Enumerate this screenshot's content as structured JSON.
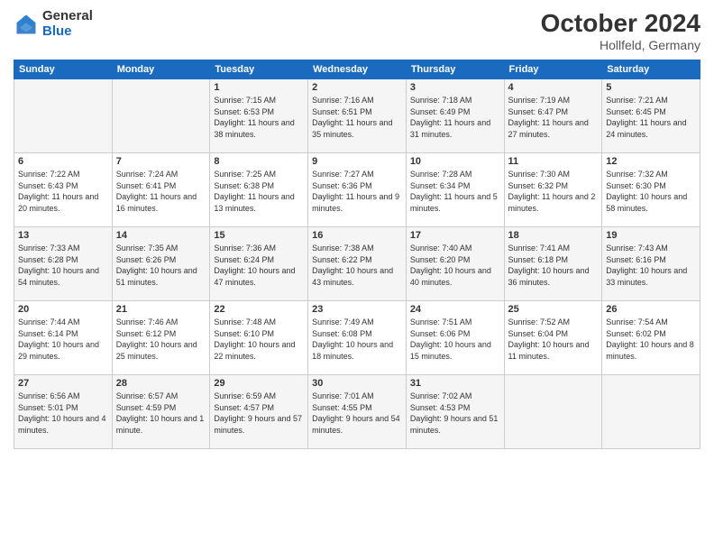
{
  "header": {
    "logo_general": "General",
    "logo_blue": "Blue",
    "month": "October 2024",
    "location": "Hollfeld, Germany"
  },
  "days_of_week": [
    "Sunday",
    "Monday",
    "Tuesday",
    "Wednesday",
    "Thursday",
    "Friday",
    "Saturday"
  ],
  "weeks": [
    [
      {
        "day": "",
        "sunrise": "",
        "sunset": "",
        "daylight": ""
      },
      {
        "day": "",
        "sunrise": "",
        "sunset": "",
        "daylight": ""
      },
      {
        "day": "1",
        "sunrise": "Sunrise: 7:15 AM",
        "sunset": "Sunset: 6:53 PM",
        "daylight": "Daylight: 11 hours and 38 minutes."
      },
      {
        "day": "2",
        "sunrise": "Sunrise: 7:16 AM",
        "sunset": "Sunset: 6:51 PM",
        "daylight": "Daylight: 11 hours and 35 minutes."
      },
      {
        "day": "3",
        "sunrise": "Sunrise: 7:18 AM",
        "sunset": "Sunset: 6:49 PM",
        "daylight": "Daylight: 11 hours and 31 minutes."
      },
      {
        "day": "4",
        "sunrise": "Sunrise: 7:19 AM",
        "sunset": "Sunset: 6:47 PM",
        "daylight": "Daylight: 11 hours and 27 minutes."
      },
      {
        "day": "5",
        "sunrise": "Sunrise: 7:21 AM",
        "sunset": "Sunset: 6:45 PM",
        "daylight": "Daylight: 11 hours and 24 minutes."
      }
    ],
    [
      {
        "day": "6",
        "sunrise": "Sunrise: 7:22 AM",
        "sunset": "Sunset: 6:43 PM",
        "daylight": "Daylight: 11 hours and 20 minutes."
      },
      {
        "day": "7",
        "sunrise": "Sunrise: 7:24 AM",
        "sunset": "Sunset: 6:41 PM",
        "daylight": "Daylight: 11 hours and 16 minutes."
      },
      {
        "day": "8",
        "sunrise": "Sunrise: 7:25 AM",
        "sunset": "Sunset: 6:38 PM",
        "daylight": "Daylight: 11 hours and 13 minutes."
      },
      {
        "day": "9",
        "sunrise": "Sunrise: 7:27 AM",
        "sunset": "Sunset: 6:36 PM",
        "daylight": "Daylight: 11 hours and 9 minutes."
      },
      {
        "day": "10",
        "sunrise": "Sunrise: 7:28 AM",
        "sunset": "Sunset: 6:34 PM",
        "daylight": "Daylight: 11 hours and 5 minutes."
      },
      {
        "day": "11",
        "sunrise": "Sunrise: 7:30 AM",
        "sunset": "Sunset: 6:32 PM",
        "daylight": "Daylight: 11 hours and 2 minutes."
      },
      {
        "day": "12",
        "sunrise": "Sunrise: 7:32 AM",
        "sunset": "Sunset: 6:30 PM",
        "daylight": "Daylight: 10 hours and 58 minutes."
      }
    ],
    [
      {
        "day": "13",
        "sunrise": "Sunrise: 7:33 AM",
        "sunset": "Sunset: 6:28 PM",
        "daylight": "Daylight: 10 hours and 54 minutes."
      },
      {
        "day": "14",
        "sunrise": "Sunrise: 7:35 AM",
        "sunset": "Sunset: 6:26 PM",
        "daylight": "Daylight: 10 hours and 51 minutes."
      },
      {
        "day": "15",
        "sunrise": "Sunrise: 7:36 AM",
        "sunset": "Sunset: 6:24 PM",
        "daylight": "Daylight: 10 hours and 47 minutes."
      },
      {
        "day": "16",
        "sunrise": "Sunrise: 7:38 AM",
        "sunset": "Sunset: 6:22 PM",
        "daylight": "Daylight: 10 hours and 43 minutes."
      },
      {
        "day": "17",
        "sunrise": "Sunrise: 7:40 AM",
        "sunset": "Sunset: 6:20 PM",
        "daylight": "Daylight: 10 hours and 40 minutes."
      },
      {
        "day": "18",
        "sunrise": "Sunrise: 7:41 AM",
        "sunset": "Sunset: 6:18 PM",
        "daylight": "Daylight: 10 hours and 36 minutes."
      },
      {
        "day": "19",
        "sunrise": "Sunrise: 7:43 AM",
        "sunset": "Sunset: 6:16 PM",
        "daylight": "Daylight: 10 hours and 33 minutes."
      }
    ],
    [
      {
        "day": "20",
        "sunrise": "Sunrise: 7:44 AM",
        "sunset": "Sunset: 6:14 PM",
        "daylight": "Daylight: 10 hours and 29 minutes."
      },
      {
        "day": "21",
        "sunrise": "Sunrise: 7:46 AM",
        "sunset": "Sunset: 6:12 PM",
        "daylight": "Daylight: 10 hours and 25 minutes."
      },
      {
        "day": "22",
        "sunrise": "Sunrise: 7:48 AM",
        "sunset": "Sunset: 6:10 PM",
        "daylight": "Daylight: 10 hours and 22 minutes."
      },
      {
        "day": "23",
        "sunrise": "Sunrise: 7:49 AM",
        "sunset": "Sunset: 6:08 PM",
        "daylight": "Daylight: 10 hours and 18 minutes."
      },
      {
        "day": "24",
        "sunrise": "Sunrise: 7:51 AM",
        "sunset": "Sunset: 6:06 PM",
        "daylight": "Daylight: 10 hours and 15 minutes."
      },
      {
        "day": "25",
        "sunrise": "Sunrise: 7:52 AM",
        "sunset": "Sunset: 6:04 PM",
        "daylight": "Daylight: 10 hours and 11 minutes."
      },
      {
        "day": "26",
        "sunrise": "Sunrise: 7:54 AM",
        "sunset": "Sunset: 6:02 PM",
        "daylight": "Daylight: 10 hours and 8 minutes."
      }
    ],
    [
      {
        "day": "27",
        "sunrise": "Sunrise: 6:56 AM",
        "sunset": "Sunset: 5:01 PM",
        "daylight": "Daylight: 10 hours and 4 minutes."
      },
      {
        "day": "28",
        "sunrise": "Sunrise: 6:57 AM",
        "sunset": "Sunset: 4:59 PM",
        "daylight": "Daylight: 10 hours and 1 minute."
      },
      {
        "day": "29",
        "sunrise": "Sunrise: 6:59 AM",
        "sunset": "Sunset: 4:57 PM",
        "daylight": "Daylight: 9 hours and 57 minutes."
      },
      {
        "day": "30",
        "sunrise": "Sunrise: 7:01 AM",
        "sunset": "Sunset: 4:55 PM",
        "daylight": "Daylight: 9 hours and 54 minutes."
      },
      {
        "day": "31",
        "sunrise": "Sunrise: 7:02 AM",
        "sunset": "Sunset: 4:53 PM",
        "daylight": "Daylight: 9 hours and 51 minutes."
      },
      {
        "day": "",
        "sunrise": "",
        "sunset": "",
        "daylight": ""
      },
      {
        "day": "",
        "sunrise": "",
        "sunset": "",
        "daylight": ""
      }
    ]
  ]
}
